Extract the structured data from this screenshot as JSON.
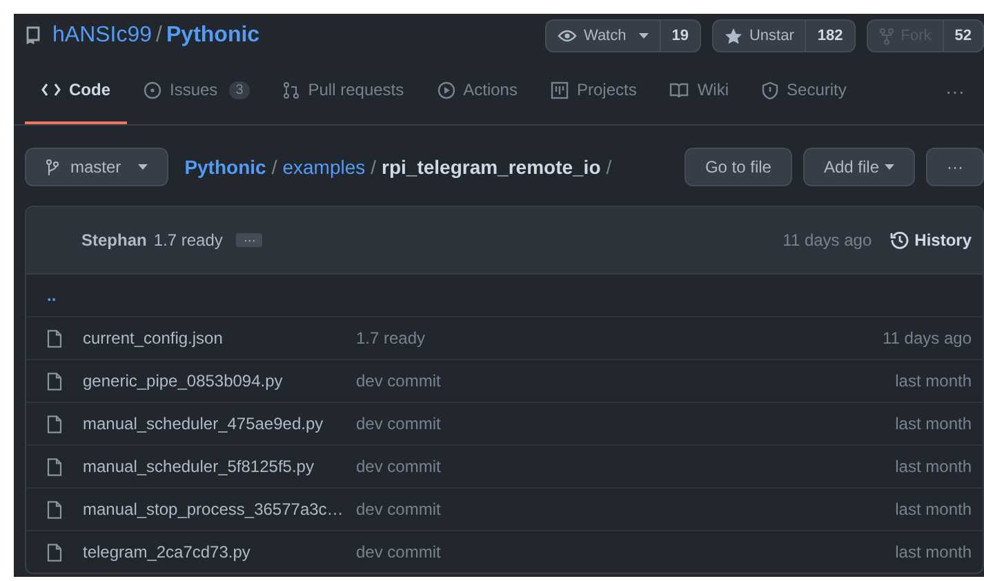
{
  "repo": {
    "owner": "hANSIc99",
    "separator": "/",
    "name": "Pythonic"
  },
  "actions": [
    {
      "kind": "watch",
      "label": "Watch",
      "count": "19",
      "disabled": false
    },
    {
      "kind": "star",
      "label": "Unstar",
      "count": "182",
      "disabled": false
    },
    {
      "kind": "fork",
      "label": "Fork",
      "count": "52",
      "disabled": true
    }
  ],
  "tabs": [
    {
      "kind": "code",
      "label": "Code",
      "selected": true
    },
    {
      "kind": "issues",
      "label": "Issues",
      "count": "3",
      "selected": false
    },
    {
      "kind": "pulls",
      "label": "Pull requests",
      "selected": false
    },
    {
      "kind": "actions",
      "label": "Actions",
      "selected": false
    },
    {
      "kind": "projects",
      "label": "Projects",
      "selected": false
    },
    {
      "kind": "wiki",
      "label": "Wiki",
      "selected": false
    },
    {
      "kind": "security",
      "label": "Security",
      "selected": false
    }
  ],
  "more": "···",
  "branch": "master",
  "breadcrumb": [
    {
      "kind": "root",
      "label": "Pythonic"
    },
    {
      "kind": "sep",
      "label": "/"
    },
    {
      "kind": "link",
      "label": "examples"
    },
    {
      "kind": "sep",
      "label": "/"
    },
    {
      "kind": "current",
      "label": "rpi_telegram_remote_io"
    },
    {
      "kind": "sep",
      "label": "/"
    }
  ],
  "buttons": [
    {
      "label": "Go to file",
      "caret": false
    },
    {
      "label": "Add file",
      "caret": true
    },
    {
      "label": "···",
      "caret": false
    }
  ],
  "commit": {
    "author": "Stephan",
    "message": "1.7 ready",
    "ellipsis": "···",
    "time": "11 days ago",
    "history": "History"
  },
  "parent_link": "..",
  "files": [
    {
      "name": "current_config.json",
      "message": "1.7 ready",
      "time": "11 days ago"
    },
    {
      "name": "generic_pipe_0853b094.py",
      "message": "dev commit",
      "time": "last month"
    },
    {
      "name": "manual_scheduler_475ae9ed.py",
      "message": "dev commit",
      "time": "last month"
    },
    {
      "name": "manual_scheduler_5f8125f5.py",
      "message": "dev commit",
      "time": "last month"
    },
    {
      "name": "manual_stop_process_36577a3c…",
      "message": "dev commit",
      "time": "last month"
    },
    {
      "name": "telegram_2ca7cd73.py",
      "message": "dev commit",
      "time": "last month"
    }
  ]
}
